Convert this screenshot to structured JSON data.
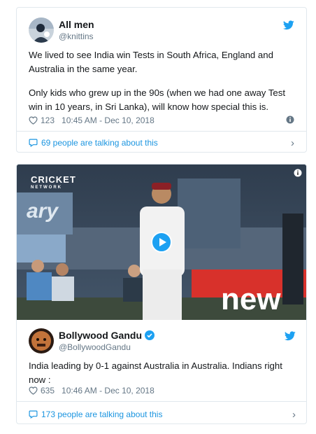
{
  "tweets": [
    {
      "name": "All men",
      "handle": "@knittins",
      "text_p1": "We lived to see India win Tests in South Africa, England and Australia in the same year.",
      "text_p2": "Only kids who grew up in the 90s (when we had one away Test win in 10 years, in Sri Lanka), will know how special this is.",
      "likes": "123",
      "timestamp": "10:45 AM - Dec 10, 2018",
      "talking": "69 people are talking about this"
    },
    {
      "name": "Bollywood Gandu",
      "handle": "@BollywoodGandu",
      "verified": true,
      "text": "India leading by 0-1 against Australia in Australia. Indians right now :",
      "likes": "635",
      "timestamp": "10:46 AM - Dec 10, 2018",
      "talking": "173 people are talking about this",
      "video": {
        "logo_line1": "CRICKET",
        "logo_line2": "NETWORK",
        "banner_left": "ary",
        "banner_right": "new"
      }
    }
  ],
  "colors": {
    "twitter_blue": "#1da1f2",
    "link_blue": "#1b95e0",
    "muted": "#657786",
    "border": "#e1e8ed"
  },
  "icons": [
    "twitter-bird-icon",
    "heart-icon",
    "info-icon",
    "comment-icon",
    "chevron-right-icon",
    "play-icon",
    "verified-badge-icon"
  ]
}
